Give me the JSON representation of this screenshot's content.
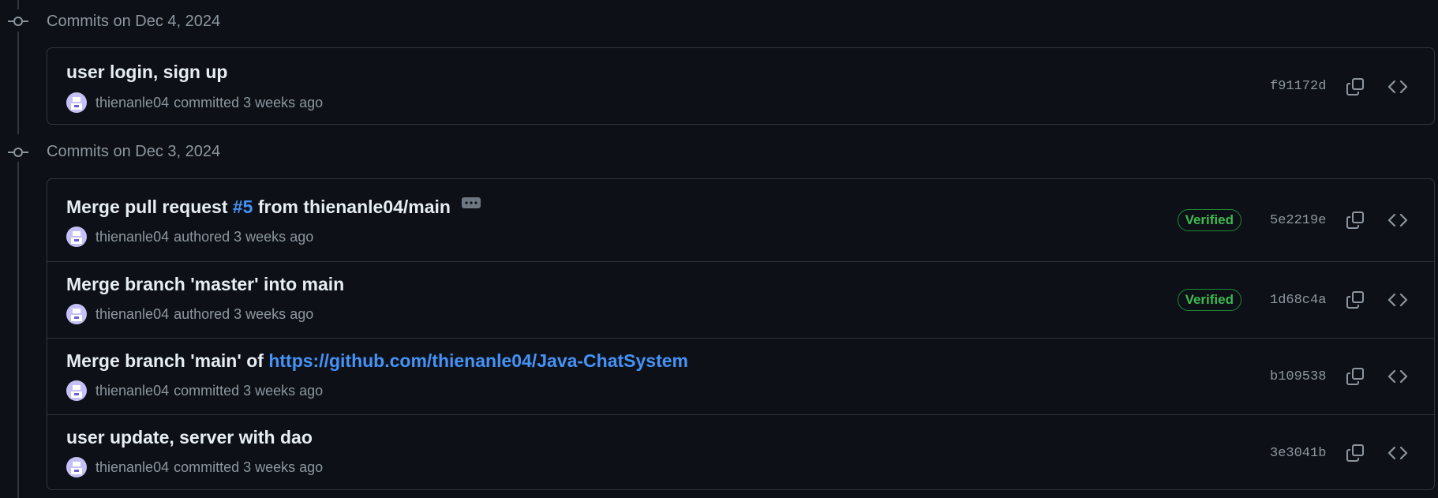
{
  "groups": [
    {
      "title": "Commits on Dec 4, 2024",
      "commits": [
        {
          "title_parts": [
            {
              "text": "user login, sign up",
              "link": false
            }
          ],
          "has_ellipsis": false,
          "author": "thienanle04",
          "action": "committed 3 weeks ago",
          "verified": "",
          "sha": "f91172d"
        }
      ]
    },
    {
      "title": "Commits on Dec 3, 2024",
      "commits": [
        {
          "title_parts": [
            {
              "text": "Merge pull request ",
              "link": false
            },
            {
              "text": "#5",
              "link": true
            },
            {
              "text": " from thienanle04/main",
              "link": false
            }
          ],
          "has_ellipsis": true,
          "author": "thienanle04",
          "action": "authored 3 weeks ago",
          "verified": "Verified",
          "sha": "5e2219e"
        },
        {
          "title_parts": [
            {
              "text": "Merge branch 'master' into main",
              "link": false
            }
          ],
          "has_ellipsis": false,
          "author": "thienanle04",
          "action": "authored 3 weeks ago",
          "verified": "Verified",
          "sha": "1d68c4a"
        },
        {
          "title_parts": [
            {
              "text": "Merge branch 'main' of ",
              "link": false
            },
            {
              "text": "https://github.com/thienanle04/Java-ChatSystem",
              "link": true
            }
          ],
          "has_ellipsis": false,
          "author": "thienanle04",
          "action": "committed 3 weeks ago",
          "verified": "",
          "sha": "b109538"
        },
        {
          "title_parts": [
            {
              "text": "user update, server with dao",
              "link": false
            }
          ],
          "has_ellipsis": false,
          "author": "thienanle04",
          "action": "committed 3 weeks ago",
          "verified": "",
          "sha": "3e3041b"
        }
      ]
    }
  ],
  "icons": {
    "commit": "git-commit-icon",
    "copy": "copy-icon",
    "browse": "code-icon",
    "avatar": "avatar"
  },
  "colors": {
    "background": "#0d1117",
    "border": "#30363d",
    "muted": "#8d96a0",
    "link": "#4493f8",
    "verified": "#3fb950"
  }
}
